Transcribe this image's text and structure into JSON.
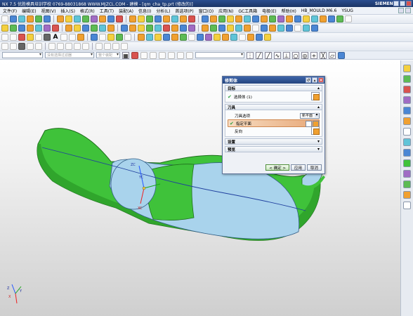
{
  "window": {
    "title": "NX 7.5  优胜模具培训学校   0769-88031868  WWW.MJZCL.COM - 建模 - [qm_cha_tp.prt (修改的)]",
    "brand": "SIEMENS"
  },
  "menubar": {
    "items": [
      "文件(F)",
      "编辑(E)",
      "视图(V)",
      "插入(S)",
      "格式(R)",
      "工具(T)",
      "装配(A)",
      "信息(I)",
      "分析(L)",
      "首选项(P)",
      "窗口(O)",
      "应用(N)",
      "GC工具箱",
      "电极(E)",
      "帮助(H)",
      "HB_MOULD M6.6",
      "YSUG"
    ]
  },
  "selection_bar": {
    "filter_placeholder": "",
    "scope_placeholder": "整个装配",
    "type_placeholder": "",
    "layer_placeholder": "没有选择过滤器"
  },
  "viewport": {
    "csys_labels": [
      "ZC",
      "YC",
      "XC"
    ],
    "corner_triad": [
      "Z",
      "Y",
      "X"
    ]
  },
  "dialog": {
    "title": "修剪体",
    "groups": [
      {
        "header": "目标",
        "row_label": "选择体 (1)"
      },
      {
        "header": "刀具",
        "option_label": "刀具选项",
        "option_value": "新平面",
        "row_label": "指定平面",
        "reverse_label": "反向"
      }
    ],
    "collapsed": [
      "设置",
      "预览"
    ],
    "buttons": {
      "ok": "< 确定 >",
      "apply": "应用",
      "cancel": "取消"
    }
  },
  "colors": {
    "body_green": "#3fc23a",
    "body_blue": "#a9d3ec",
    "title_blue": "#24457f"
  }
}
